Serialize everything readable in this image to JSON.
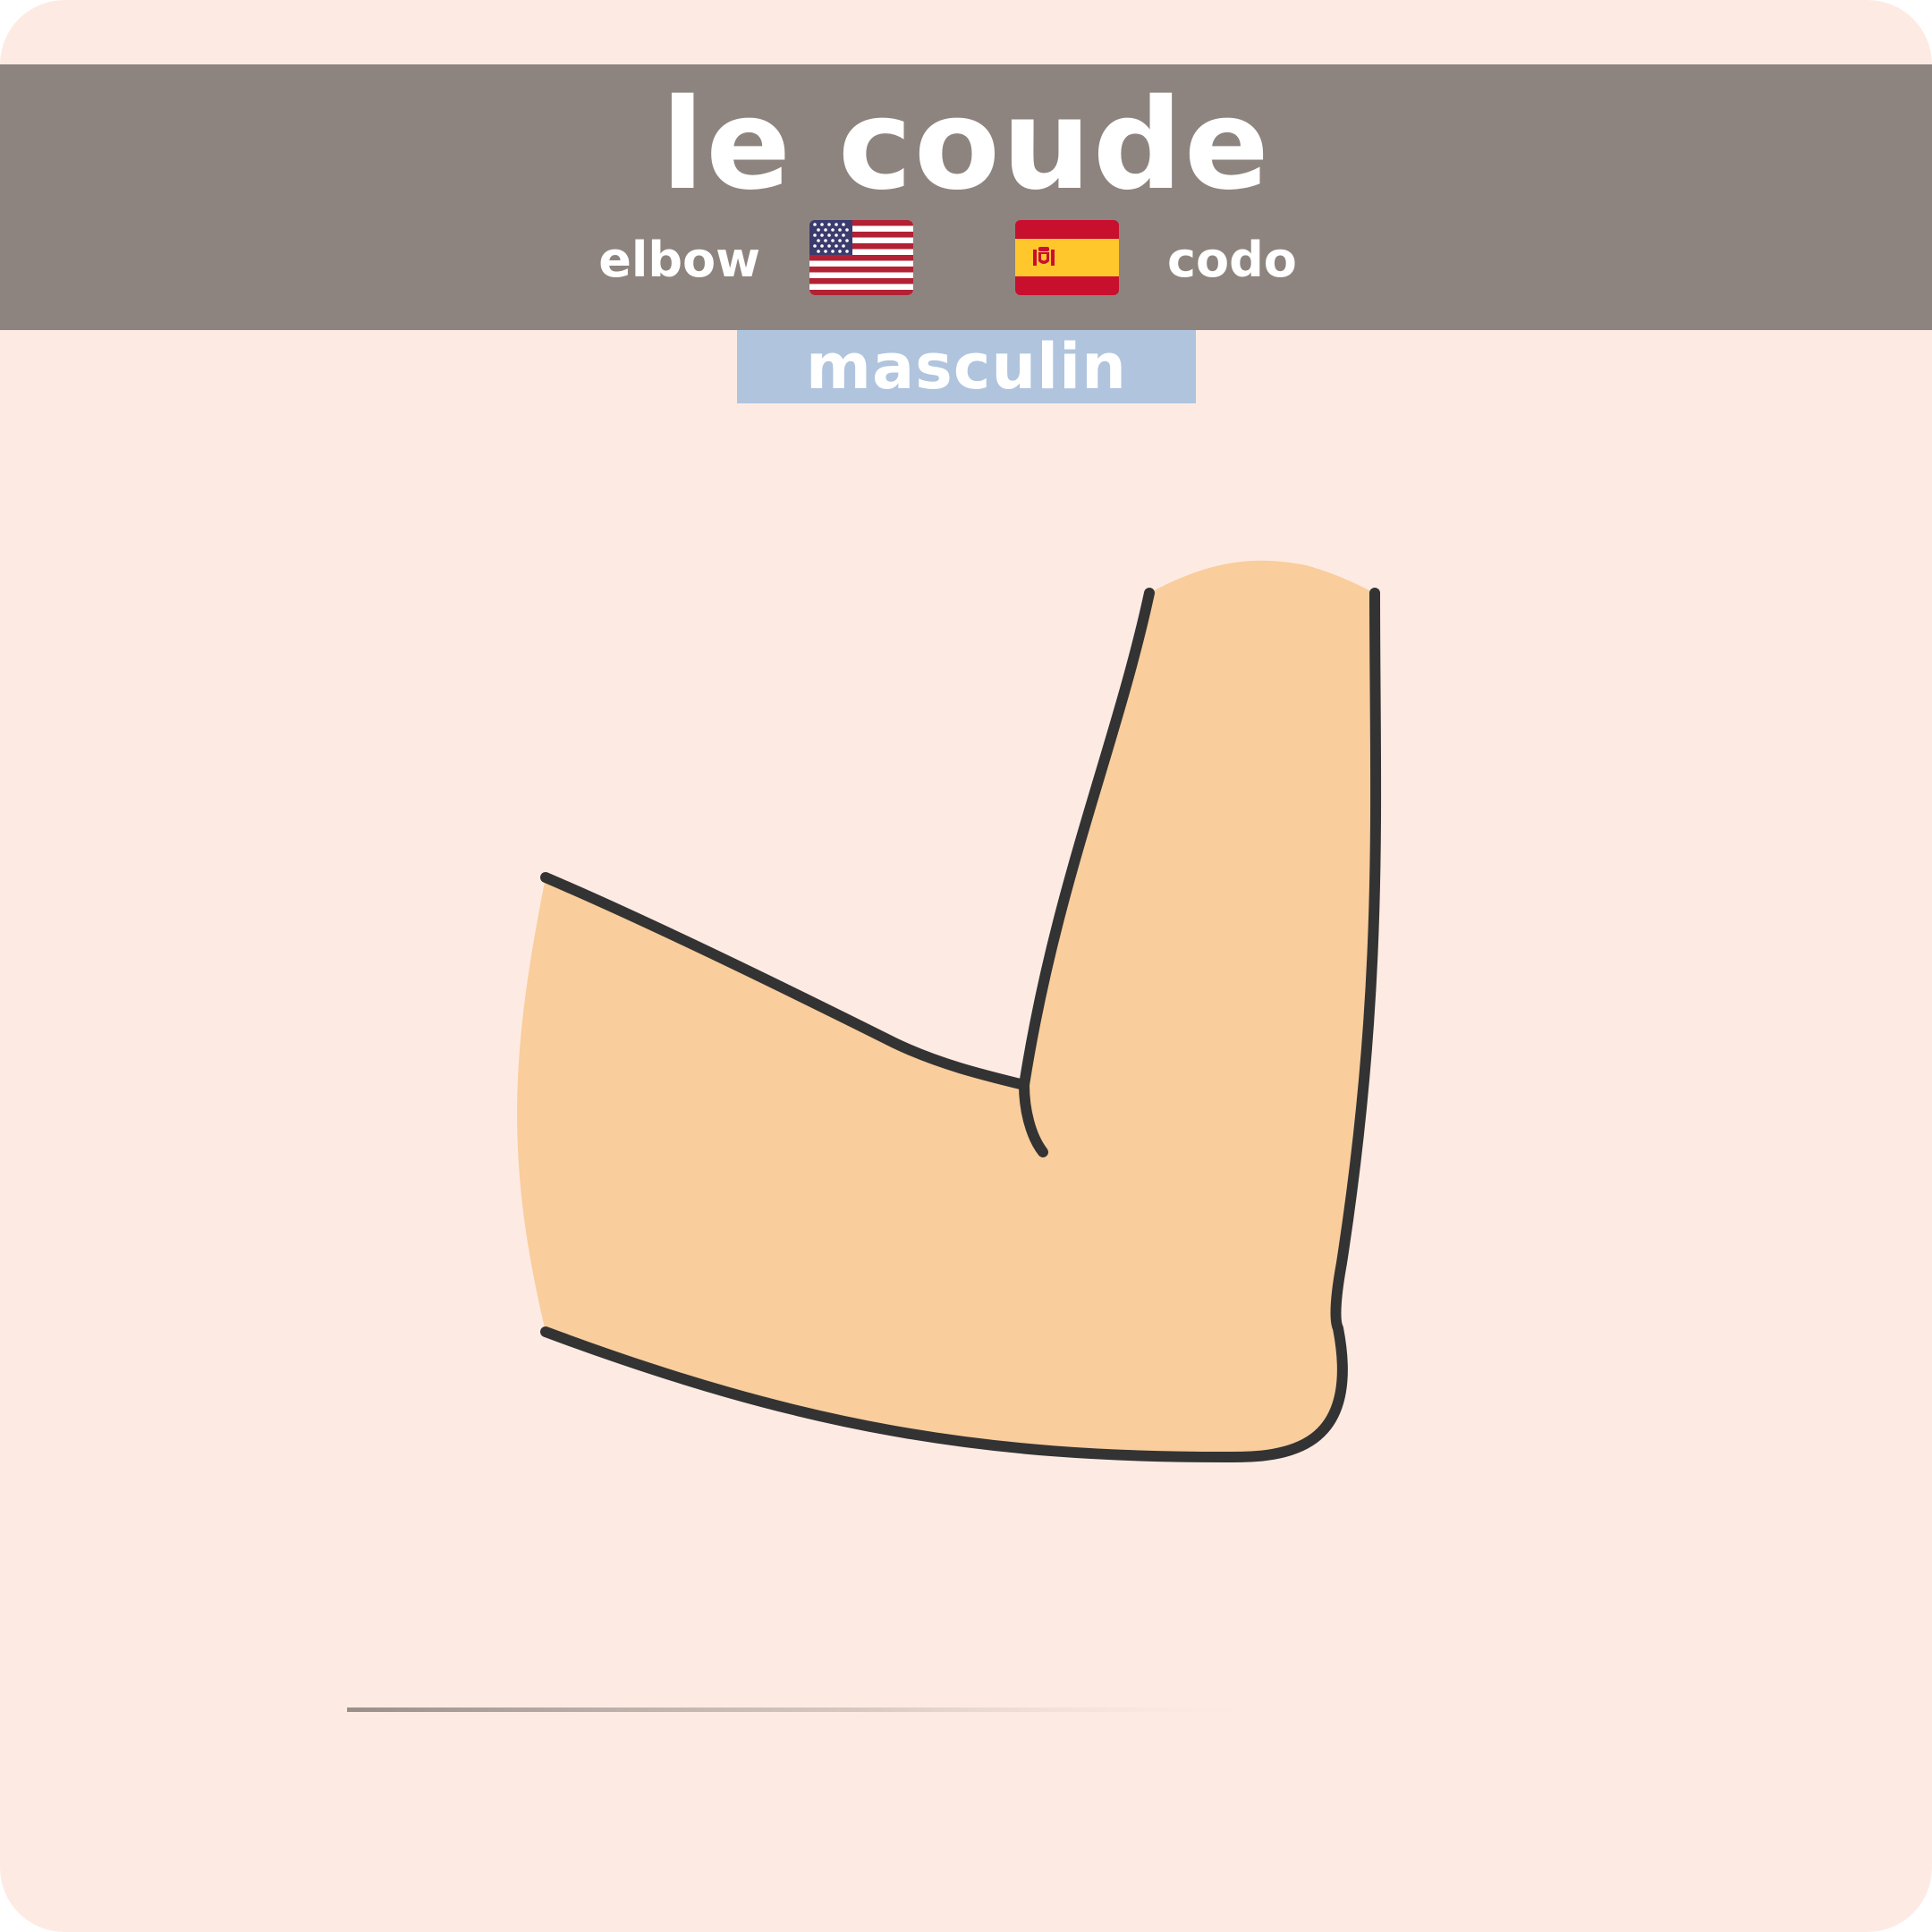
{
  "card": {
    "title": "le coude",
    "translations": {
      "english": "elbow",
      "spanish": "codo"
    },
    "gender_label": "masculin",
    "flags": {
      "english": "us-flag-icon",
      "spanish": "spain-flag-icon"
    },
    "illustration": "elbow-illustration"
  },
  "colors": {
    "background": "#fdebe3",
    "header": "#8e847f",
    "gender_badge": "#b0c4de",
    "skin": "#f9cd9c",
    "outline": "#333333"
  }
}
